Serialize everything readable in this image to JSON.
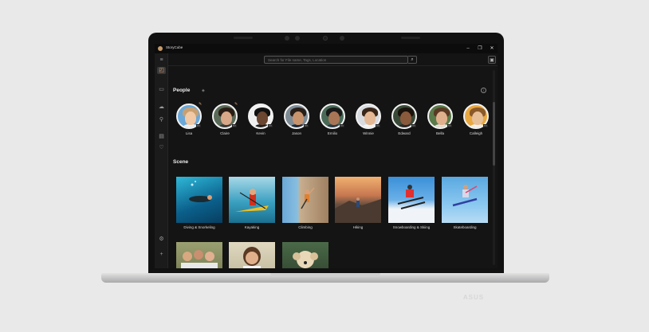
{
  "window": {
    "app_title": "StoryCube",
    "minimize": "–",
    "maximize": "❐",
    "close": "✕"
  },
  "brand": "ASUS",
  "search": {
    "placeholder": "Search for File name, Tags, Location",
    "button_icon": "search-icon"
  },
  "sidebar": {
    "items": [
      {
        "name": "menu",
        "glyph": "≡"
      },
      {
        "name": "storycube",
        "glyph": "◰"
      },
      {
        "name": "folder",
        "glyph": "▭"
      },
      {
        "name": "cloud",
        "glyph": "☁"
      },
      {
        "name": "link",
        "glyph": "⚲"
      },
      {
        "name": "album",
        "glyph": "▤"
      },
      {
        "name": "favorites",
        "glyph": "♡"
      },
      {
        "name": "settings",
        "glyph": "⚙"
      },
      {
        "name": "add",
        "glyph": "+"
      }
    ]
  },
  "people": {
    "title": "People",
    "items": [
      {
        "name": "Lisa"
      },
      {
        "name": "Claire"
      },
      {
        "name": "Kevin"
      },
      {
        "name": "Jason"
      },
      {
        "name": "Emilio"
      },
      {
        "name": "Winnie"
      },
      {
        "name": "Edward"
      },
      {
        "name": "Bella"
      },
      {
        "name": "Calleigh"
      }
    ]
  },
  "scenes": {
    "title": "Scene",
    "items": [
      {
        "label": "Diving & Snorkeling"
      },
      {
        "label": "Kayaking"
      },
      {
        "label": "Climbing"
      },
      {
        "label": "Hiking"
      },
      {
        "label": "Snowboarding & Skiing"
      },
      {
        "label": "Skateboarding"
      }
    ]
  }
}
